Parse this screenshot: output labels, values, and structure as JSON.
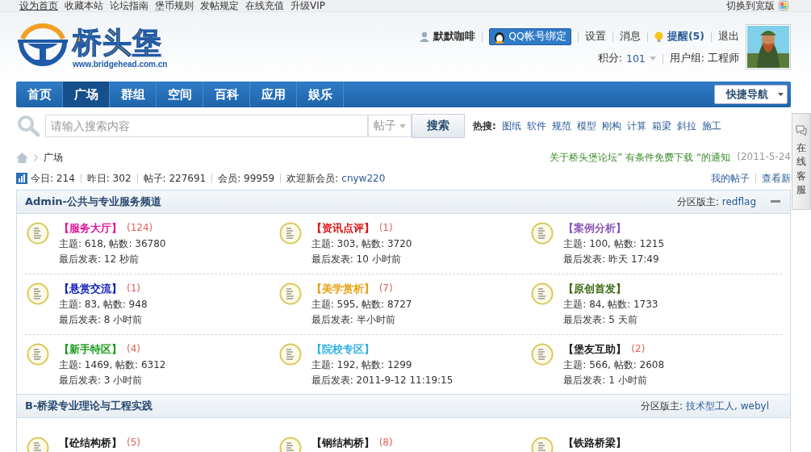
{
  "top_links": [
    {
      "label": "设为首页",
      "underline": true
    },
    {
      "label": "收藏本站",
      "underline": false
    },
    {
      "label": "论坛指南",
      "underline": false
    },
    {
      "label": "堡币规则",
      "underline": false
    },
    {
      "label": "发帖规定",
      "underline": false
    },
    {
      "label": "在线充值",
      "underline": false
    },
    {
      "label": "升级VIP",
      "underline": false
    }
  ],
  "wide_switch": "切换到宽版",
  "logo": {
    "name": "桥头堡",
    "url": "www.bridgehead.com.cn"
  },
  "user": {
    "name": "默默咖啡",
    "qq_button": "QQ帐号绑定",
    "links": [
      "设置",
      "消息"
    ],
    "notice": "提醒(5)",
    "logout": "退出",
    "points_label": "积分:",
    "points": "101",
    "group": "用户组: 工程师"
  },
  "nav": [
    {
      "label": "首页",
      "selected": false
    },
    {
      "label": "广场",
      "selected": true
    },
    {
      "label": "群组",
      "selected": false
    },
    {
      "label": "空间",
      "selected": false
    },
    {
      "label": "百科",
      "selected": false
    },
    {
      "label": "应用",
      "selected": false
    },
    {
      "label": "娱乐",
      "selected": false
    }
  ],
  "quick_nav": "快捷导航",
  "search": {
    "placeholder": "请输入搜索内容",
    "scope": "帖子",
    "button": "搜索",
    "hot_label": "热搜:",
    "hot": [
      "图纸",
      "软件",
      "规范",
      "模型",
      "刚构",
      "计算",
      "箱梁",
      "斜拉",
      "施工"
    ]
  },
  "side_tab": "在线客服",
  "breadcrumb": "广场",
  "notice": {
    "text": "关于桥头堡论坛” 有条件免费下载 “的通知",
    "date": "(2011-5-24"
  },
  "stats": [
    "今日: 214",
    "昨日: 302",
    "帖子: 227691",
    "会员: 99959"
  ],
  "welcome": {
    "label": "欢迎新会员:",
    "name": "cnyw220"
  },
  "my_links": [
    "我的帖子",
    "查看新"
  ],
  "sections": [
    {
      "title": "Admin-公共与专业服务频道",
      "mod_label": "分区版主:",
      "mods": "redflag",
      "collapse": true,
      "forums": [
        {
          "name": "【服务大厅】",
          "color": "#e0149a",
          "count": "(124)",
          "stats": "主题: 618, 帖数: 36780",
          "last": "最后发表: 12 秒前"
        },
        {
          "name": "【资讯点评】",
          "color": "#e01010",
          "count": "(1)",
          "stats": "主题: 303, 帖数: 3720",
          "last": "最后发表: 10 小时前"
        },
        {
          "name": "【案例分析】",
          "color": "#8a55b8",
          "stats": "主题: 100, 帖数: 1215",
          "last": "最后发表: 昨天 17:49"
        },
        {
          "name": "【悬赏交流】",
          "color": "#1020c0",
          "count": "(1)",
          "stats": "主题: 83, 帖数: 948",
          "last": "最后发表: 8 小时前"
        },
        {
          "name": "【美学赏析】",
          "color": "#e8a010",
          "count": "(7)",
          "stats": "主题: 595, 帖数: 8727",
          "last": "最后发表: 半小时前"
        },
        {
          "name": "【原创首发】",
          "color": "#3a6a10",
          "stats": "主题: 84, 帖数: 1733",
          "last": "最后发表: 5 天前"
        },
        {
          "name": "【新手特区】",
          "color": "#1a9a1a",
          "count": "(4)",
          "stats": "主题: 1469, 帖数: 6312",
          "last": "最后发表: 3 小时前"
        },
        {
          "name": "【院校专区】",
          "color": "#30b0e0",
          "stats": "主题: 192, 帖数: 1299",
          "last": "最后发表: 2011-9-12 11:19:15"
        },
        {
          "name": "【堡友互助】",
          "color": "#222222",
          "count": "(2)",
          "stats": "主题: 566, 帖数: 2608",
          "last": "最后发表: 1 小时前"
        }
      ]
    },
    {
      "title": "B-桥梁专业理论与工程实践",
      "mod_label": "分区版主:",
      "mods": "技术型工人, webyl",
      "collapse": false,
      "forums": [
        {
          "name": "【砼结构桥】",
          "color": "#222222",
          "count": "(5)"
        },
        {
          "name": "【钢结构桥】",
          "color": "#222222",
          "count": "(8)"
        },
        {
          "name": "【铁路桥梁】",
          "color": "#222222"
        }
      ]
    }
  ]
}
